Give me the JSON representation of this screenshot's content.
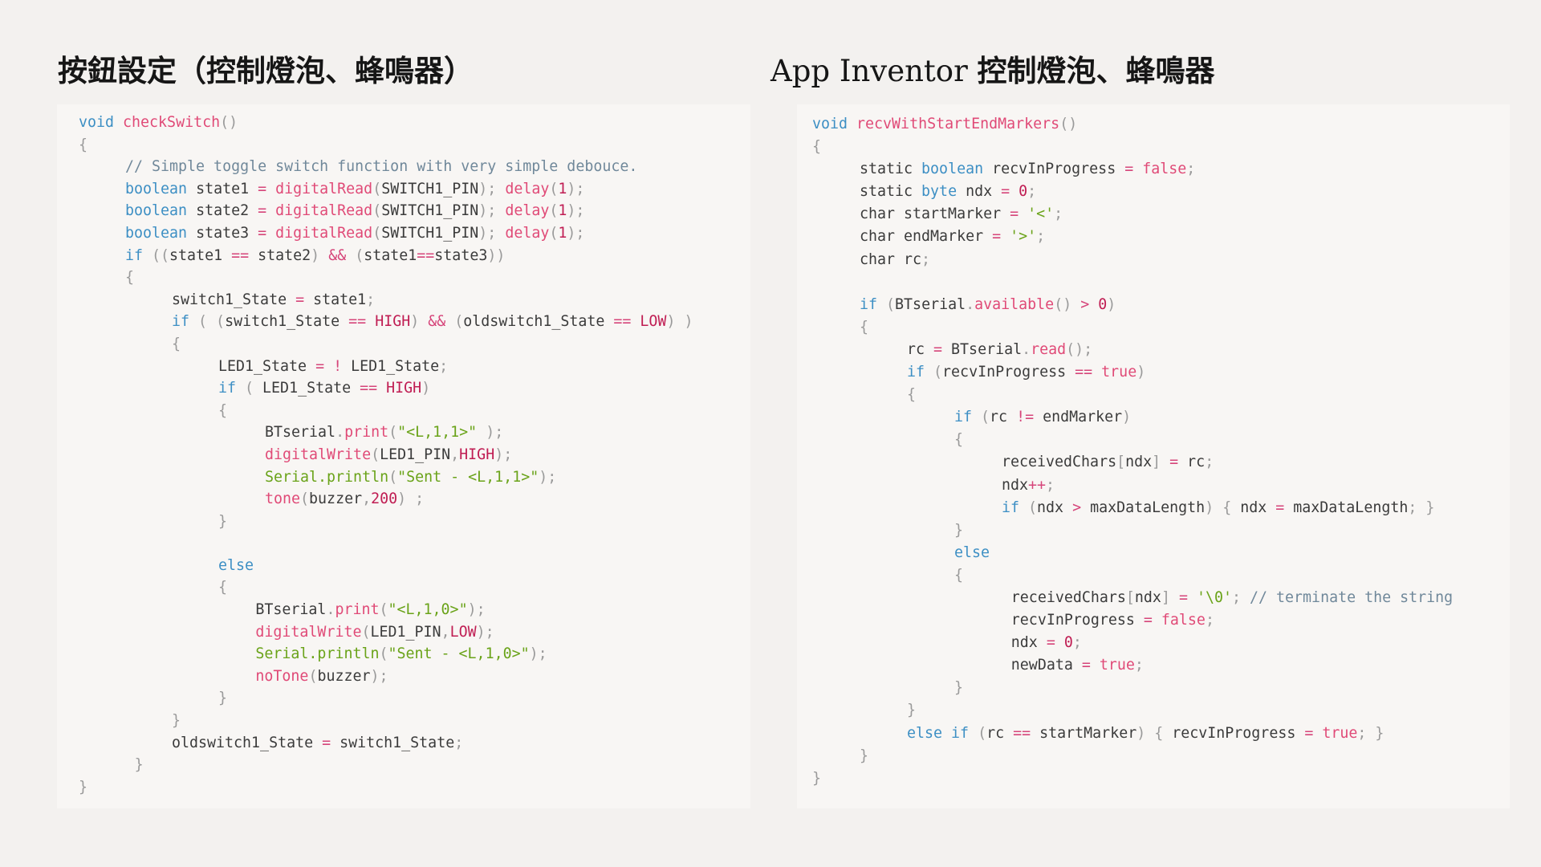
{
  "left_panel": {
    "title": "按鈕設定（控制燈泡、蜂鳴器）",
    "lines": [
      {
        "indent": 0,
        "tokens": [
          [
            "kw",
            "void "
          ],
          [
            "fn",
            "checkSwitch"
          ],
          [
            "pun",
            "()"
          ]
        ]
      },
      {
        "indent": 0,
        "tokens": [
          [
            "pun",
            "{"
          ]
        ]
      },
      {
        "indent": 1,
        "tokens": [
          [
            "com",
            "// Simple toggle switch function with very simple debouce."
          ]
        ]
      },
      {
        "indent": 1,
        "tokens": [
          [
            "kw",
            "boolean "
          ],
          [
            "tx",
            "state1 "
          ],
          [
            "op",
            "= "
          ],
          [
            "fn",
            "digitalRead"
          ],
          [
            "pun",
            "("
          ],
          [
            "tx",
            "SWITCH1_PIN"
          ],
          [
            "pun",
            "); "
          ],
          [
            "fn",
            "delay"
          ],
          [
            "pun",
            "("
          ],
          [
            "num",
            "1"
          ],
          [
            "pun",
            ");"
          ]
        ]
      },
      {
        "indent": 1,
        "tokens": [
          [
            "kw",
            "boolean "
          ],
          [
            "tx",
            "state2 "
          ],
          [
            "op",
            "= "
          ],
          [
            "fn",
            "digitalRead"
          ],
          [
            "pun",
            "("
          ],
          [
            "tx",
            "SWITCH1_PIN"
          ],
          [
            "pun",
            "); "
          ],
          [
            "fn",
            "delay"
          ],
          [
            "pun",
            "("
          ],
          [
            "num",
            "1"
          ],
          [
            "pun",
            ");"
          ]
        ]
      },
      {
        "indent": 1,
        "tokens": [
          [
            "kw",
            "boolean "
          ],
          [
            "tx",
            "state3 "
          ],
          [
            "op",
            "= "
          ],
          [
            "fn",
            "digitalRead"
          ],
          [
            "pun",
            "("
          ],
          [
            "tx",
            "SWITCH1_PIN"
          ],
          [
            "pun",
            "); "
          ],
          [
            "fn",
            "delay"
          ],
          [
            "pun",
            "("
          ],
          [
            "num",
            "1"
          ],
          [
            "pun",
            ");"
          ]
        ]
      },
      {
        "indent": 1,
        "tokens": [
          [
            "kw",
            "if "
          ],
          [
            "pun",
            "(("
          ],
          [
            "tx",
            "state1 "
          ],
          [
            "op",
            "== "
          ],
          [
            "tx",
            "state2"
          ],
          [
            "pun",
            ") "
          ],
          [
            "op",
            "&& "
          ],
          [
            "pun",
            "("
          ],
          [
            "tx",
            "state1"
          ],
          [
            "op",
            "=="
          ],
          [
            "tx",
            "state3"
          ],
          [
            "pun",
            "))"
          ]
        ]
      },
      {
        "indent": 1,
        "tokens": [
          [
            "pun",
            "{"
          ]
        ]
      },
      {
        "indent": 2,
        "tokens": [
          [
            "tx",
            "switch1_State "
          ],
          [
            "op",
            "= "
          ],
          [
            "tx",
            "state1"
          ],
          [
            "pun",
            ";"
          ]
        ]
      },
      {
        "indent": 2,
        "tokens": [
          [
            "kw",
            "if "
          ],
          [
            "pun",
            "( ("
          ],
          [
            "tx",
            "switch1_State "
          ],
          [
            "op",
            "== "
          ],
          [
            "num",
            "HIGH"
          ],
          [
            "pun",
            ") "
          ],
          [
            "op",
            "&& "
          ],
          [
            "pun",
            "("
          ],
          [
            "tx",
            "oldswitch1_State "
          ],
          [
            "op",
            "== "
          ],
          [
            "num",
            "LOW"
          ],
          [
            "pun",
            ") )"
          ]
        ]
      },
      {
        "indent": 2,
        "tokens": [
          [
            "pun",
            "{"
          ]
        ]
      },
      {
        "indent": 3,
        "tokens": [
          [
            "tx",
            "LED1_State "
          ],
          [
            "op",
            "= ! "
          ],
          [
            "tx",
            "LED1_State"
          ],
          [
            "pun",
            ";"
          ]
        ]
      },
      {
        "indent": 3,
        "tokens": [
          [
            "kw",
            "if "
          ],
          [
            "pun",
            "( "
          ],
          [
            "tx",
            "LED1_State "
          ],
          [
            "op",
            "== "
          ],
          [
            "num",
            "HIGH"
          ],
          [
            "pun",
            ")"
          ]
        ]
      },
      {
        "indent": 3,
        "tokens": [
          [
            "pun",
            "{"
          ]
        ]
      },
      {
        "indent": 4,
        "tokens": [
          [
            "tx",
            "BTserial"
          ],
          [
            "pun",
            "."
          ],
          [
            "fn",
            "print"
          ],
          [
            "pun",
            "("
          ],
          [
            "str",
            "\"<L,1,1>\""
          ],
          [
            "pun",
            " );"
          ]
        ]
      },
      {
        "indent": 4,
        "tokens": [
          [
            "fn",
            "digitalWrite"
          ],
          [
            "pun",
            "("
          ],
          [
            "tx",
            "LED1_PIN"
          ],
          [
            "pun",
            ","
          ],
          [
            "num",
            "HIGH"
          ],
          [
            "pun",
            ");"
          ]
        ]
      },
      {
        "indent": 4,
        "tokens": [
          [
            "str",
            "Serial.println"
          ],
          [
            "pun",
            "("
          ],
          [
            "str",
            "\"Sent - <L,1,1>\""
          ],
          [
            "pun",
            ");"
          ]
        ]
      },
      {
        "indent": 4,
        "tokens": [
          [
            "fn",
            "tone"
          ],
          [
            "pun",
            "("
          ],
          [
            "tx",
            "buzzer"
          ],
          [
            "pun",
            ","
          ],
          [
            "num",
            "200"
          ],
          [
            "pun",
            ") ;"
          ]
        ]
      },
      {
        "indent": 3,
        "tokens": [
          [
            "pun",
            "}"
          ]
        ]
      },
      {
        "indent": 0,
        "tokens": []
      },
      {
        "indent": 3,
        "tokens": [
          [
            "kw",
            "else"
          ]
        ]
      },
      {
        "indent": 3,
        "tokens": [
          [
            "pun",
            "{"
          ]
        ]
      },
      {
        "indent": 3.8,
        "tokens": [
          [
            "tx",
            "BTserial"
          ],
          [
            "pun",
            "."
          ],
          [
            "fn",
            "print"
          ],
          [
            "pun",
            "("
          ],
          [
            "str",
            "\"<L,1,0>\""
          ],
          [
            "pun",
            ");"
          ]
        ]
      },
      {
        "indent": 3.8,
        "tokens": [
          [
            "fn",
            "digitalWrite"
          ],
          [
            "pun",
            "("
          ],
          [
            "tx",
            "LED1_PIN"
          ],
          [
            "pun",
            ","
          ],
          [
            "num",
            "LOW"
          ],
          [
            "pun",
            ");"
          ]
        ]
      },
      {
        "indent": 3.8,
        "tokens": [
          [
            "str",
            "Serial.println"
          ],
          [
            "pun",
            "("
          ],
          [
            "str",
            "\"Sent - <L,1,0>\""
          ],
          [
            "pun",
            ");"
          ]
        ]
      },
      {
        "indent": 3.8,
        "tokens": [
          [
            "fn",
            "noTone"
          ],
          [
            "pun",
            "("
          ],
          [
            "tx",
            "buzzer"
          ],
          [
            "pun",
            ");"
          ]
        ]
      },
      {
        "indent": 3,
        "tokens": [
          [
            "pun",
            "}"
          ]
        ]
      },
      {
        "indent": 2,
        "tokens": [
          [
            "pun",
            "}"
          ]
        ]
      },
      {
        "indent": 2,
        "tokens": [
          [
            "tx",
            "oldswitch1_State "
          ],
          [
            "op",
            "= "
          ],
          [
            "tx",
            "switch1_State"
          ],
          [
            "pun",
            ";"
          ]
        ]
      },
      {
        "indent": 1.2,
        "tokens": [
          [
            "pun",
            "}"
          ]
        ]
      },
      {
        "indent": 0,
        "tokens": [
          [
            "pun",
            "}"
          ]
        ]
      }
    ]
  },
  "right_panel": {
    "title_latin": "App Inventor ",
    "title_cjk": "控制燈泡、蜂鳴器",
    "lines": [
      {
        "indent": 0,
        "tokens": [
          [
            "kw",
            "void "
          ],
          [
            "fn",
            "recvWithStartEndMarkers"
          ],
          [
            "pun",
            "()"
          ]
        ]
      },
      {
        "indent": 0,
        "tokens": [
          [
            "pun",
            "{"
          ]
        ]
      },
      {
        "indent": 1,
        "tokens": [
          [
            "tx",
            "static "
          ],
          [
            "kw",
            "boolean "
          ],
          [
            "tx",
            "recvInProgress "
          ],
          [
            "op",
            "= "
          ],
          [
            "fn",
            "false"
          ],
          [
            "pun",
            ";"
          ]
        ]
      },
      {
        "indent": 1,
        "tokens": [
          [
            "tx",
            "static "
          ],
          [
            "kw",
            "byte "
          ],
          [
            "tx",
            "ndx "
          ],
          [
            "op",
            "= "
          ],
          [
            "num",
            "0"
          ],
          [
            "pun",
            ";"
          ]
        ]
      },
      {
        "indent": 1,
        "tokens": [
          [
            "tx",
            "char startMarker "
          ],
          [
            "op",
            "= "
          ],
          [
            "str",
            "'<'"
          ],
          [
            "pun",
            ";"
          ]
        ]
      },
      {
        "indent": 1,
        "tokens": [
          [
            "tx",
            "char endMarker "
          ],
          [
            "op",
            "= "
          ],
          [
            "str",
            "'>'"
          ],
          [
            "pun",
            ";"
          ]
        ]
      },
      {
        "indent": 1,
        "tokens": [
          [
            "tx",
            "char rc"
          ],
          [
            "pun",
            ";"
          ]
        ]
      },
      {
        "indent": 0,
        "tokens": []
      },
      {
        "indent": 1,
        "tokens": [
          [
            "kw",
            "if "
          ],
          [
            "pun",
            "("
          ],
          [
            "tx",
            "BTserial"
          ],
          [
            "pun",
            "."
          ],
          [
            "fn",
            "available"
          ],
          [
            "pun",
            "() "
          ],
          [
            "op",
            "> "
          ],
          [
            "num",
            "0"
          ],
          [
            "pun",
            ")"
          ]
        ]
      },
      {
        "indent": 1,
        "tokens": [
          [
            "pun",
            "{"
          ]
        ]
      },
      {
        "indent": 2,
        "tokens": [
          [
            "tx",
            "rc "
          ],
          [
            "op",
            "= "
          ],
          [
            "tx",
            "BTserial"
          ],
          [
            "pun",
            "."
          ],
          [
            "fn",
            "read"
          ],
          [
            "pun",
            "();"
          ]
        ]
      },
      {
        "indent": 2,
        "tokens": [
          [
            "kw",
            "if "
          ],
          [
            "pun",
            "("
          ],
          [
            "tx",
            "recvInProgress "
          ],
          [
            "op",
            "== "
          ],
          [
            "fn",
            "true"
          ],
          [
            "pun",
            ")"
          ]
        ]
      },
      {
        "indent": 2,
        "tokens": [
          [
            "pun",
            "{"
          ]
        ]
      },
      {
        "indent": 3,
        "tokens": [
          [
            "kw",
            "if "
          ],
          [
            "pun",
            "("
          ],
          [
            "tx",
            "rc "
          ],
          [
            "op",
            "!= "
          ],
          [
            "tx",
            "endMarker"
          ],
          [
            "pun",
            ")"
          ]
        ]
      },
      {
        "indent": 3,
        "tokens": [
          [
            "pun",
            "{"
          ]
        ]
      },
      {
        "indent": 4,
        "tokens": [
          [
            "tx",
            "receivedChars"
          ],
          [
            "pun",
            "["
          ],
          [
            "tx",
            "ndx"
          ],
          [
            "pun",
            "] "
          ],
          [
            "op",
            "= "
          ],
          [
            "tx",
            "rc"
          ],
          [
            "pun",
            ";"
          ]
        ]
      },
      {
        "indent": 4,
        "tokens": [
          [
            "tx",
            "ndx"
          ],
          [
            "op",
            "++"
          ],
          [
            "pun",
            ";"
          ]
        ]
      },
      {
        "indent": 4,
        "tokens": [
          [
            "kw",
            "if "
          ],
          [
            "pun",
            "("
          ],
          [
            "tx",
            "ndx "
          ],
          [
            "op",
            "> "
          ],
          [
            "tx",
            "maxDataLength"
          ],
          [
            "pun",
            ") { "
          ],
          [
            "tx",
            "ndx "
          ],
          [
            "op",
            "= "
          ],
          [
            "tx",
            "maxDataLength"
          ],
          [
            "pun",
            "; }"
          ]
        ]
      },
      {
        "indent": 3,
        "tokens": [
          [
            "pun",
            "}"
          ]
        ]
      },
      {
        "indent": 3,
        "tokens": [
          [
            "kw",
            "else"
          ]
        ]
      },
      {
        "indent": 3,
        "tokens": [
          [
            "pun",
            "{"
          ]
        ]
      },
      {
        "indent": 4.2,
        "tokens": [
          [
            "tx",
            "receivedChars"
          ],
          [
            "pun",
            "["
          ],
          [
            "tx",
            "ndx"
          ],
          [
            "pun",
            "] "
          ],
          [
            "op",
            "= "
          ],
          [
            "str",
            "'\\0'"
          ],
          [
            "pun",
            "; "
          ],
          [
            "com",
            "// terminate the string"
          ]
        ]
      },
      {
        "indent": 4.2,
        "tokens": [
          [
            "tx",
            "recvInProgress "
          ],
          [
            "op",
            "= "
          ],
          [
            "fn",
            "false"
          ],
          [
            "pun",
            ";"
          ]
        ]
      },
      {
        "indent": 4.2,
        "tokens": [
          [
            "tx",
            "ndx "
          ],
          [
            "op",
            "= "
          ],
          [
            "num",
            "0"
          ],
          [
            "pun",
            ";"
          ]
        ]
      },
      {
        "indent": 4.2,
        "tokens": [
          [
            "tx",
            "newData "
          ],
          [
            "op",
            "= "
          ],
          [
            "fn",
            "true"
          ],
          [
            "pun",
            ";"
          ]
        ]
      },
      {
        "indent": 3,
        "tokens": [
          [
            "pun",
            "}"
          ]
        ]
      },
      {
        "indent": 2,
        "tokens": [
          [
            "pun",
            "}"
          ]
        ]
      },
      {
        "indent": 2,
        "tokens": [
          [
            "kw",
            "else if "
          ],
          [
            "pun",
            "("
          ],
          [
            "tx",
            "rc "
          ],
          [
            "op",
            "== "
          ],
          [
            "tx",
            "startMarker"
          ],
          [
            "pun",
            ") { "
          ],
          [
            "tx",
            "recvInProgress "
          ],
          [
            "op",
            "= "
          ],
          [
            "fn",
            "true"
          ],
          [
            "pun",
            "; }"
          ]
        ]
      },
      {
        "indent": 1,
        "tokens": [
          [
            "pun",
            "}"
          ]
        ]
      },
      {
        "indent": 0,
        "tokens": [
          [
            "pun",
            "}"
          ]
        ]
      }
    ]
  }
}
